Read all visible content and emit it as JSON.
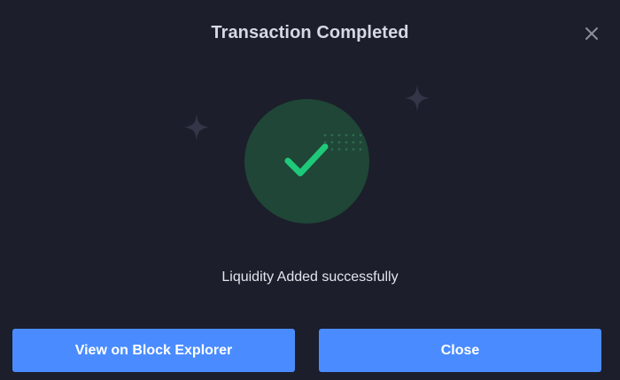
{
  "modal": {
    "title": "Transaction Completed",
    "close_icon": "close-icon",
    "status_icon": "checkmark-icon",
    "message": "Liquidity Added successfully",
    "buttons": {
      "explorer_label": "View on Block Explorer",
      "close_label": "Close"
    }
  },
  "colors": {
    "background": "#1c1e2b",
    "success_circle": "#1f4636",
    "success_check": "#1fc97a",
    "button": "#4a8cff",
    "title_text": "#d6d9e3"
  }
}
